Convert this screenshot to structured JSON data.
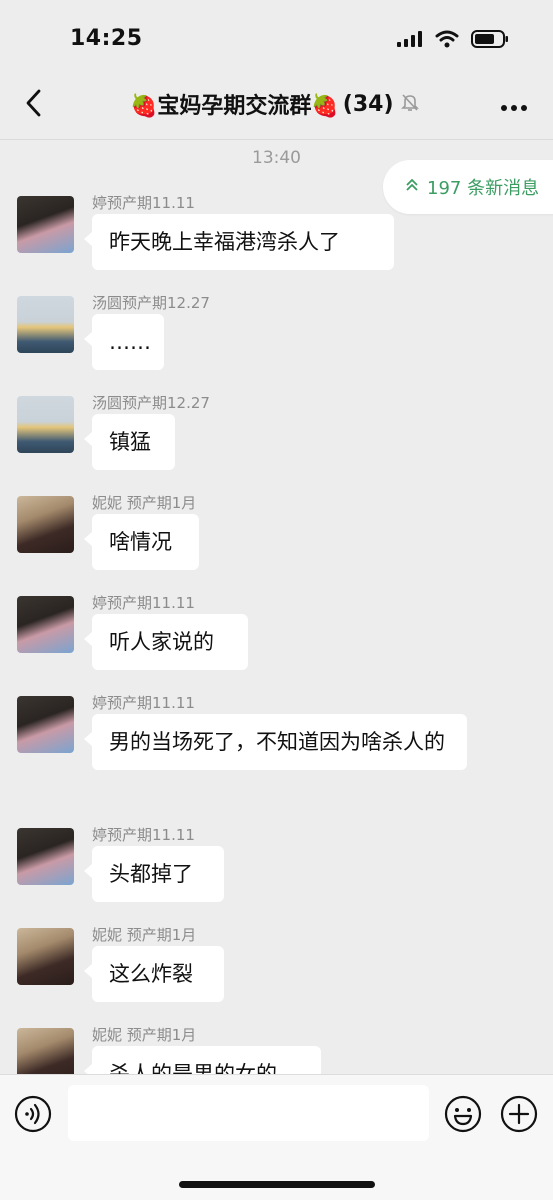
{
  "status": {
    "time": "14:25"
  },
  "nav": {
    "title": "🍓宝妈孕期交流群🍓",
    "count": "(34)",
    "icons": [
      "back-arrow-icon",
      "mute-bell-icon",
      "more-dots-icon"
    ]
  },
  "chat": {
    "timestamp": "13:40",
    "new_messages": "197 条新消息",
    "accent_color": "#3c9d63",
    "messages": [
      {
        "sender": "婷预产期11.11",
        "text": "昨天晚上幸福港湾杀人了"
      },
      {
        "sender": "汤圆预产期12.27",
        "text": "……"
      },
      {
        "sender": "汤圆预产期12.27",
        "text": "镇猛"
      },
      {
        "sender": "妮妮 预产期1月",
        "text": "啥情况"
      },
      {
        "sender": "婷预产期11.11",
        "text": "听人家说的"
      },
      {
        "sender": "婷预产期11.11",
        "text": "男的当场死了，不知道因为啥杀人的"
      },
      {
        "sender": "婷预产期11.11",
        "text": "头都掉了"
      },
      {
        "sender": "妮妮 预产期1月",
        "text": "这么炸裂"
      },
      {
        "sender": "妮妮 预产期1月",
        "text": "杀人的是男的女的"
      }
    ]
  },
  "input": {
    "value": "",
    "icons": [
      "voice-icon",
      "emoji-icon",
      "plus-icon"
    ]
  }
}
